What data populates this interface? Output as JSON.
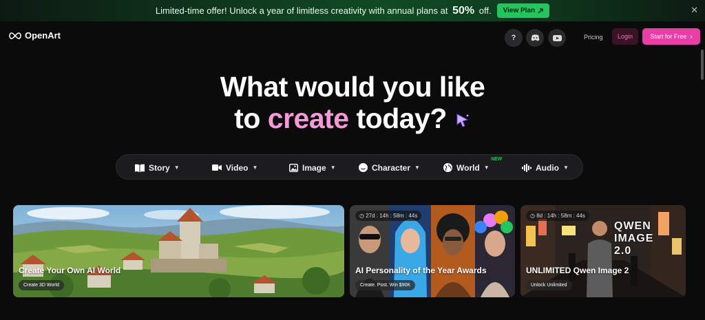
{
  "banner": {
    "text_before": "Limited-time offer! Unlock a year of limitless creativity with annual plans at",
    "percent": "50%",
    "text_after": "off.",
    "cta": "View Plan"
  },
  "nav": {
    "logo": "OpenArt",
    "pricing": "Pricing",
    "login": "Login",
    "start": "Start for Free"
  },
  "hero": {
    "line1": "What would you like",
    "to": "to",
    "accent": "create",
    "rest": "today?"
  },
  "categories": [
    {
      "label": "Story",
      "icon": "book-icon"
    },
    {
      "label": "Video",
      "icon": "video-camera-icon"
    },
    {
      "label": "Image",
      "icon": "image-icon"
    },
    {
      "label": "Character",
      "icon": "face-icon"
    },
    {
      "label": "World",
      "icon": "globe-icon"
    },
    {
      "label": "Audio",
      "icon": "audio-wave-icon"
    }
  ],
  "new_badge": "NEW",
  "cards": [
    {
      "title": "Create Your Own AI World",
      "cta": "Create 3D World"
    },
    {
      "title": "AI Personality of the Year Awards",
      "cta": "Create. Post. Win $90K",
      "timer": "27d : 14h : 58m : 44s"
    },
    {
      "title": "UNLIMITED Qwen Image 2",
      "cta": "Unlock Unlimited",
      "timer": "8d : 14h : 58m : 44s",
      "overlay_text": "QWEN IMAGE 2.0"
    }
  ],
  "colors": {
    "accent_pink": "#e83fa6",
    "banner_green": "#22c55e"
  }
}
